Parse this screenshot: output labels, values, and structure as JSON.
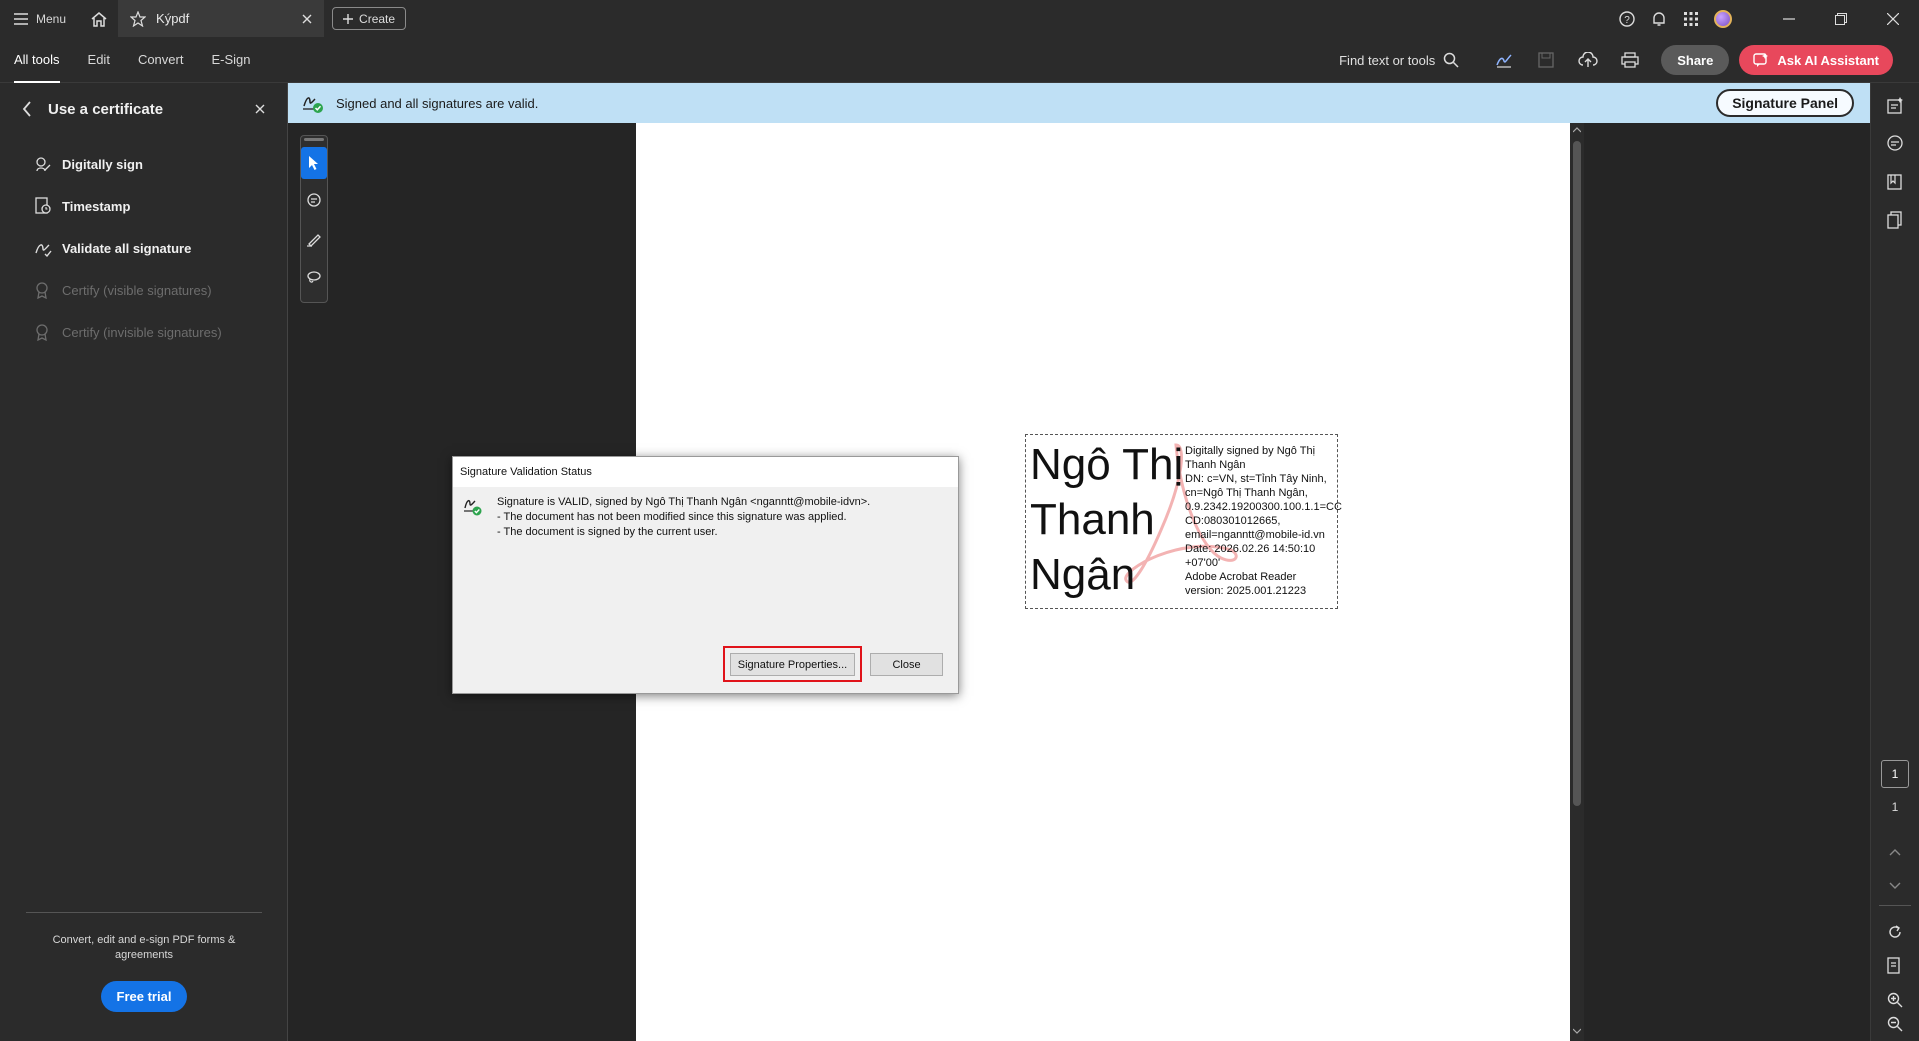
{
  "titlebar": {
    "menu_label": "Menu",
    "tab_title": "Kýpdf",
    "create_label": "Create"
  },
  "toolbar": {
    "tabs": [
      {
        "label": "All tools"
      },
      {
        "label": "Edit"
      },
      {
        "label": "Convert"
      },
      {
        "label": "E-Sign"
      }
    ],
    "find_label": "Find text or tools",
    "share_label": "Share",
    "ai_label": "Ask AI Assistant"
  },
  "left_panel": {
    "title": "Use a certificate",
    "items": [
      {
        "label": "Digitally sign",
        "enabled": true
      },
      {
        "label": "Timestamp",
        "enabled": true
      },
      {
        "label": "Validate all signature",
        "enabled": true
      },
      {
        "label": "Certify (visible signatures)",
        "enabled": false
      },
      {
        "label": "Certify (invisible signatures)",
        "enabled": false
      }
    ],
    "footer_text": "Convert, edit and e-sign PDF forms & agreements",
    "trial_label": "Free trial"
  },
  "signature_bar": {
    "message": "Signed and all signatures are valid.",
    "panel_button": "Signature Panel"
  },
  "signature_appearance": {
    "name_lines": [
      "Ngô Thị",
      "Thanh",
      "Ngân"
    ],
    "details": [
      "Digitally signed by Ngô Thị",
      "Thanh Ngân",
      "DN: c=VN, st=Tỉnh Tây Ninh,",
      "cn=Ngô Thị Thanh Ngân,",
      "0.9.2342.19200300.100.1.1=CC",
      "CD:080301012665,",
      "email=nganntt@mobile-id.vn",
      "Date: 2026.02.26 14:50:10",
      "+07'00'",
      "Adobe Acrobat Reader",
      "version: 2025.001.21223"
    ]
  },
  "dialog": {
    "title": "Signature Validation Status",
    "lines": [
      "Signature is VALID, signed by Ngô Thị Thanh Ngân <nganntt@mobile-idvn>.",
      "- The document has not been modified since this signature was applied.",
      "- The document is signed by the current user."
    ],
    "properties_button": "Signature Properties...",
    "close_button": "Close"
  },
  "page_nav": {
    "current_page": "1",
    "total_pages": "1"
  },
  "colors": {
    "accent_blue": "#1473e6",
    "ai_red": "#e8485c",
    "signed_bar": "#bfe0f5",
    "highlight_red": "#e0131a"
  }
}
